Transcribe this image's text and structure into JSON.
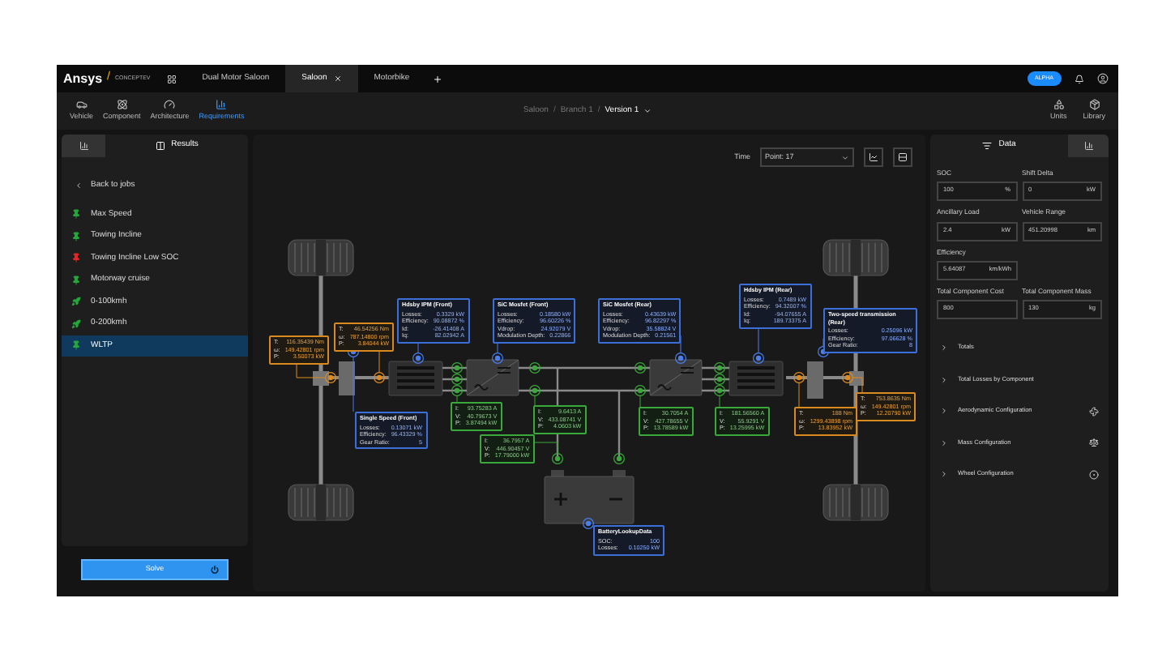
{
  "logo": {
    "brand": "Ansys",
    "divider": "/",
    "product": "CONCEPTEV"
  },
  "tabs": [
    {
      "label": "Dual Motor Saloon",
      "selected": false,
      "closable": false
    },
    {
      "label": "Saloon",
      "selected": true,
      "closable": true
    },
    {
      "label": "Motorbike",
      "selected": false,
      "closable": false
    }
  ],
  "badge": "ALPHA",
  "toolbar": [
    {
      "kind": "vehicle",
      "label": "Vehicle",
      "selected": false
    },
    {
      "kind": "component",
      "label": "Component",
      "selected": false
    },
    {
      "kind": "architecture",
      "label": "Architecture",
      "selected": false
    },
    {
      "kind": "requirements",
      "label": "Requirements",
      "selected": true
    }
  ],
  "breadcrumb": {
    "items": [
      "Saloon",
      "Branch 1",
      "Version 1"
    ],
    "separator": "/"
  },
  "toolbar_right": [
    {
      "kind": "units",
      "label": "Units"
    },
    {
      "kind": "library",
      "label": "Library"
    }
  ],
  "left_panel": {
    "tabs": [
      {
        "kind": "chart",
        "selected": false
      },
      {
        "kind": "results",
        "label": "Results",
        "selected": true
      }
    ],
    "back_link": "Back to jobs",
    "jobs": [
      {
        "name": "Max Speed",
        "kind": "pin",
        "color": "#24a83a",
        "selected": false
      },
      {
        "name": "Towing Incline",
        "kind": "pin",
        "color": "#24a83a",
        "selected": false
      },
      {
        "name": "Towing Incline Low SOC",
        "kind": "pin",
        "color": "#e52626",
        "selected": false
      },
      {
        "name": "Motorway cruise",
        "kind": "pin",
        "color": "#24a83a",
        "selected": false
      },
      {
        "name": "0-100kmh",
        "kind": "rocket",
        "color": "#24a83a",
        "selected": false
      },
      {
        "name": "0-200kmh",
        "kind": "rocket",
        "color": "#24a83a",
        "selected": false
      },
      {
        "name": "WLTP",
        "kind": "pin",
        "color": "#24a83a",
        "selected": true
      }
    ]
  },
  "solve_button": "Solve",
  "time": {
    "label": "Time",
    "value": "Point: 17"
  },
  "diagram": {
    "boxes": [
      {
        "kind": "torque",
        "rows": [
          {
            "label": "T:",
            "value": "116.35439 Nm"
          },
          {
            "label": "ω:",
            "value": "149.42801 rpm"
          },
          {
            "label": "P:",
            "value": "3.50073 kW"
          }
        ]
      },
      {
        "kind": "torque",
        "rows": [
          {
            "label": "T:",
            "value": "46.54256 Nm"
          },
          {
            "label": "ω:",
            "value": "787.14800 rpm"
          },
          {
            "label": "P:",
            "value": "3.84044 kW"
          }
        ]
      },
      {
        "kind": "component",
        "title": "Hdsby IPM (Front)",
        "rows": [
          {
            "label": "Losses:",
            "value": "0.3329 kW"
          },
          {
            "label": "Efficiency:",
            "value": "90.08872 %"
          },
          {
            "label": "Id:",
            "value": "-26.41408 A"
          },
          {
            "label": "Iq:",
            "value": "82.02942 A"
          }
        ]
      },
      {
        "kind": "component",
        "title": "SiC Mosfet (Front)",
        "rows": [
          {
            "label": "Losses:",
            "value": "0.18580 kW"
          },
          {
            "label": "Efficiency:",
            "value": "96.60226 %"
          },
          {
            "label": "Vdrop:",
            "value": "24.92079 V"
          },
          {
            "label": "Modulation Depth:",
            "value": "0.22866"
          }
        ]
      },
      {
        "kind": "component",
        "title": "SiC Mosfet (Rear)",
        "rows": [
          {
            "label": "Losses:",
            "value": "0.43639 kW"
          },
          {
            "label": "Efficiency:",
            "value": "96.82297 %"
          },
          {
            "label": "Vdrop:",
            "value": "35.58824 V"
          },
          {
            "label": "Modulation Depth:",
            "value": "0.21561"
          }
        ]
      },
      {
        "kind": "component",
        "title": "Single Speed (Front)",
        "rows": [
          {
            "label": "Losses:",
            "value": "0.13071 kW"
          },
          {
            "label": "Efficiency:",
            "value": "96.43329 %"
          },
          {
            "label": "Gear Ratio:",
            "value": "5"
          }
        ]
      },
      {
        "kind": "electrical",
        "rows": [
          {
            "label": "I:",
            "value": "93.75283 A"
          },
          {
            "label": "V:",
            "value": "40.79673 V"
          },
          {
            "label": "P:",
            "value": "3.87494 kW"
          }
        ]
      },
      {
        "kind": "electrical",
        "rows": [
          {
            "label": "I:",
            "value": "9.6413 A"
          },
          {
            "label": "V:",
            "value": "433.08741 V"
          },
          {
            "label": "P:",
            "value": "4.0603 kW"
          }
        ]
      },
      {
        "kind": "electrical",
        "rows": [
          {
            "label": "I:",
            "value": "36.7957 A"
          },
          {
            "label": "V:",
            "value": "446.90457 V"
          },
          {
            "label": "P:",
            "value": "17.79000 kW"
          }
        ]
      },
      {
        "kind": "electrical",
        "rows": [
          {
            "label": "I:",
            "value": "30.7054 A"
          },
          {
            "label": "V:",
            "value": "427.78655 V"
          },
          {
            "label": "P:",
            "value": "13.78589 kW"
          }
        ]
      },
      {
        "kind": "electrical",
        "rows": [
          {
            "label": "I:",
            "value": "181.56560 A"
          },
          {
            "label": "V:",
            "value": "55.9291 V"
          },
          {
            "label": "P:",
            "value": "13.25995 kW"
          }
        ]
      },
      {
        "kind": "component",
        "title": "Hdsby IPM (Rear)",
        "rows": [
          {
            "label": "Losses:",
            "value": "0.7489 kW"
          },
          {
            "label": "Efficiency:",
            "value": "94.32007 %"
          },
          {
            "label": "Id:",
            "value": "-94.07655 A"
          },
          {
            "label": "Iq:",
            "value": "189.73375 A"
          }
        ]
      },
      {
        "kind": "component",
        "title": "Two-speed transmission (Rear)",
        "rows": [
          {
            "label": "Losses:",
            "value": "0.25096 kW"
          },
          {
            "label": "Efficiency:",
            "value": "97.06628 %"
          },
          {
            "label": "Gear Ratio:",
            "value": "8"
          }
        ]
      },
      {
        "kind": "torque",
        "rows": [
          {
            "label": "T:",
            "value": "188 Nm"
          },
          {
            "label": "ω:",
            "value": "1299.43898 rpm"
          },
          {
            "label": "P:",
            "value": "13.83952 kW"
          }
        ]
      },
      {
        "kind": "torque",
        "rows": [
          {
            "label": "T:",
            "value": "753.8635 Nm"
          },
          {
            "label": "ω:",
            "value": "149.42801 rpm"
          },
          {
            "label": "P:",
            "value": "12.20790 kW"
          }
        ]
      },
      {
        "kind": "component",
        "title": "BatteryLookupData",
        "rows": [
          {
            "label": "SOC:",
            "value": "100"
          },
          {
            "label": "Losses:",
            "value": "0.10250 kW"
          }
        ]
      }
    ]
  },
  "right_panel": {
    "tabs": [
      {
        "kind": "data",
        "label": "Data",
        "selected": true
      },
      {
        "kind": "chart",
        "selected": false
      }
    ],
    "fields": [
      {
        "label": "SOC",
        "value": "100",
        "unit": "%"
      },
      {
        "label": "Shift Delta",
        "value": "0",
        "unit": "kW"
      },
      {
        "label": "Ancillary Load",
        "value": "2.4",
        "unit": "kW"
      },
      {
        "label": "Vehicle Range",
        "value": "451.20998",
        "unit": "km"
      },
      {
        "label": "Efficiency",
        "value": "5.64087",
        "unit": "km/kWh"
      },
      {
        "label": "Total Component Cost",
        "value": "800"
      },
      {
        "label": "Total Component Mass",
        "value": "130",
        "unit": "kg"
      }
    ],
    "sections": [
      {
        "label": "Totals",
        "expanded": false
      },
      {
        "label": "Total Losses by Component",
        "expanded": false
      },
      {
        "label": "Aerodynamic Configuration",
        "kind": "fan",
        "expanded": false
      },
      {
        "label": "Mass Configuration",
        "kind": "scale",
        "expanded": false
      },
      {
        "label": "Wheel Configuration",
        "kind": "wheel",
        "expanded": false
      }
    ]
  }
}
